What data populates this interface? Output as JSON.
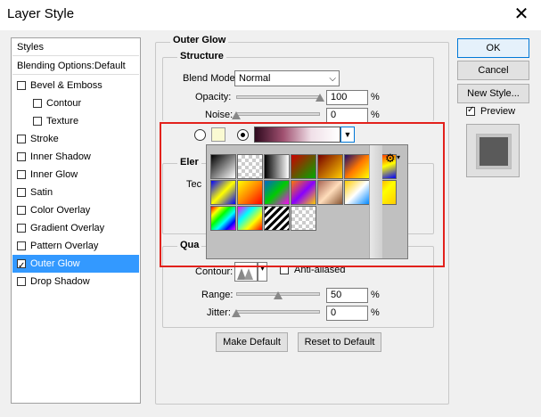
{
  "window": {
    "title": "Layer Style",
    "close_glyph": "✕"
  },
  "styles_panel": {
    "header": "Styles",
    "blending": "Blending Options:Default",
    "items": [
      {
        "label": "Bevel & Emboss",
        "checked": false
      },
      {
        "label": "Contour",
        "checked": false
      },
      {
        "label": "Texture",
        "checked": false
      },
      {
        "label": "Stroke",
        "checked": false
      },
      {
        "label": "Inner Shadow",
        "checked": false
      },
      {
        "label": "Inner Glow",
        "checked": false
      },
      {
        "label": "Satin",
        "checked": false
      },
      {
        "label": "Color Overlay",
        "checked": false
      },
      {
        "label": "Gradient Overlay",
        "checked": false
      },
      {
        "label": "Pattern Overlay",
        "checked": false
      },
      {
        "label": "Outer Glow",
        "checked": true,
        "selected": true
      },
      {
        "label": "Drop Shadow",
        "checked": false
      }
    ]
  },
  "outer_glow": {
    "title": "Outer Glow",
    "structure": {
      "title": "Structure",
      "blend_mode_label": "Blend Mode:",
      "blend_mode_value": "Normal",
      "opacity_label": "Opacity:",
      "opacity_value": "100",
      "opacity_level": 100,
      "noise_label": "Noise:",
      "noise_value": "0",
      "noise_level": 0,
      "pct": "%"
    },
    "elements": {
      "title_partial": "Eler",
      "technique_partial": "Tec"
    },
    "quality": {
      "title_partial": "Qua",
      "contour_label": "Contour:",
      "anti_aliased_label": "Anti-aliased",
      "range_label": "Range:",
      "range_value": "50",
      "range_level": 50,
      "jitter_label": "Jitter:",
      "jitter_value": "0",
      "jitter_level": 0
    },
    "make_default": "Make Default",
    "reset_default": "Reset to Default",
    "gear_glyph": "⚙"
  },
  "buttons": {
    "ok": "OK",
    "cancel": "Cancel",
    "new_style": "New Style...",
    "preview_label": "Preview",
    "preview_checked": true
  },
  "gradient_swatches": [
    [
      "linear-gradient(135deg,#000,#fff)",
      "repeating-conic-gradient(#ccc 0 25%, #fff 0 50%) 0 0/8px 8px",
      "linear-gradient(90deg,#000,#fff)",
      "linear-gradient(135deg,#c00,#0a0)",
      "linear-gradient(135deg,#700,#fc0)",
      "linear-gradient(135deg,#1a0a6e,#f70,#ff0)",
      "linear-gradient(160deg,#f00,#ff0,#00f)"
    ],
    [
      "linear-gradient(135deg,#00f,#ff0,#00f)",
      "linear-gradient(135deg,#ff0,#f80,#f00)",
      "linear-gradient(135deg,#06c,#0c0,#f0f)",
      "linear-gradient(135deg,#f70,#80f,#fc0)",
      "linear-gradient(135deg,#a65,#fdb,#853)",
      "linear-gradient(135deg,#fc0,#fff,#08f)",
      "linear-gradient(135deg,#f80,#ff0,#fc0)"
    ],
    [
      "linear-gradient(135deg,#f00,#ff0,#0f0,#0ff,#00f,#f0f)",
      "linear-gradient(135deg,#f0f,#0ff,#ff0,#f00)",
      "repeating-linear-gradient(135deg,#000 0 3px,#fff 3px 6px)",
      "repeating-conic-gradient(#ccc 0 25%, #fff 0 50%) 0 0/8px 8px"
    ]
  ]
}
